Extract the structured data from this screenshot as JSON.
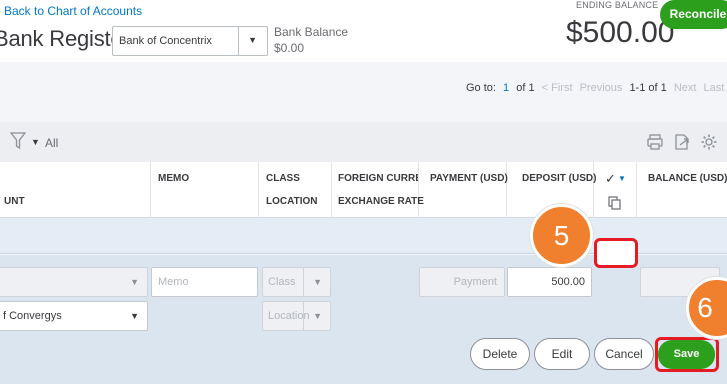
{
  "header": {
    "back_link": "Back to Chart of Accounts",
    "title": "Bank Register",
    "account": "Bank of Concentrix",
    "bank_balance_label": "Bank Balance",
    "bank_balance_value": "$0.00",
    "ending_balance_label": "ENDING BALANCE",
    "ending_balance_value": "$500.00",
    "reconcile_label": "Reconcile"
  },
  "pager": {
    "goto_label": "Go to:",
    "page_current": "1",
    "page_of": "of 1",
    "first": "< First",
    "previous": "Previous",
    "range": "1-1 of 1",
    "next": "Next",
    "last": "Last >"
  },
  "toolbar": {
    "filter_value": "All"
  },
  "columns": {
    "account": "UNT",
    "memo": "MEMO",
    "class": "CLASS",
    "location": "LOCATION",
    "foreign_currency": "FOREIGN CURRENC",
    "exchange_rate": "EXCHANGE RATE",
    "payment": "PAYMENT (USD)",
    "deposit": "DEPOSIT (USD)",
    "check_mark": "✓",
    "balance": "BALANCE (USD)"
  },
  "edit_row": {
    "memo_placeholder": "Memo",
    "class_placeholder": "Class",
    "location_placeholder": "Location",
    "payment_placeholder": "Payment",
    "deposit_value": "500.00",
    "payee_value": "f Convergys"
  },
  "actions": {
    "delete": "Delete",
    "edit": "Edit",
    "cancel": "Cancel",
    "save": "Save"
  },
  "steps": {
    "step_a": "5",
    "step_b": "6"
  },
  "colors": {
    "brand_green": "#2ca01c",
    "link_blue": "#0077c5",
    "highlight_red": "#e41b23",
    "step_orange": "#f07f2e"
  }
}
